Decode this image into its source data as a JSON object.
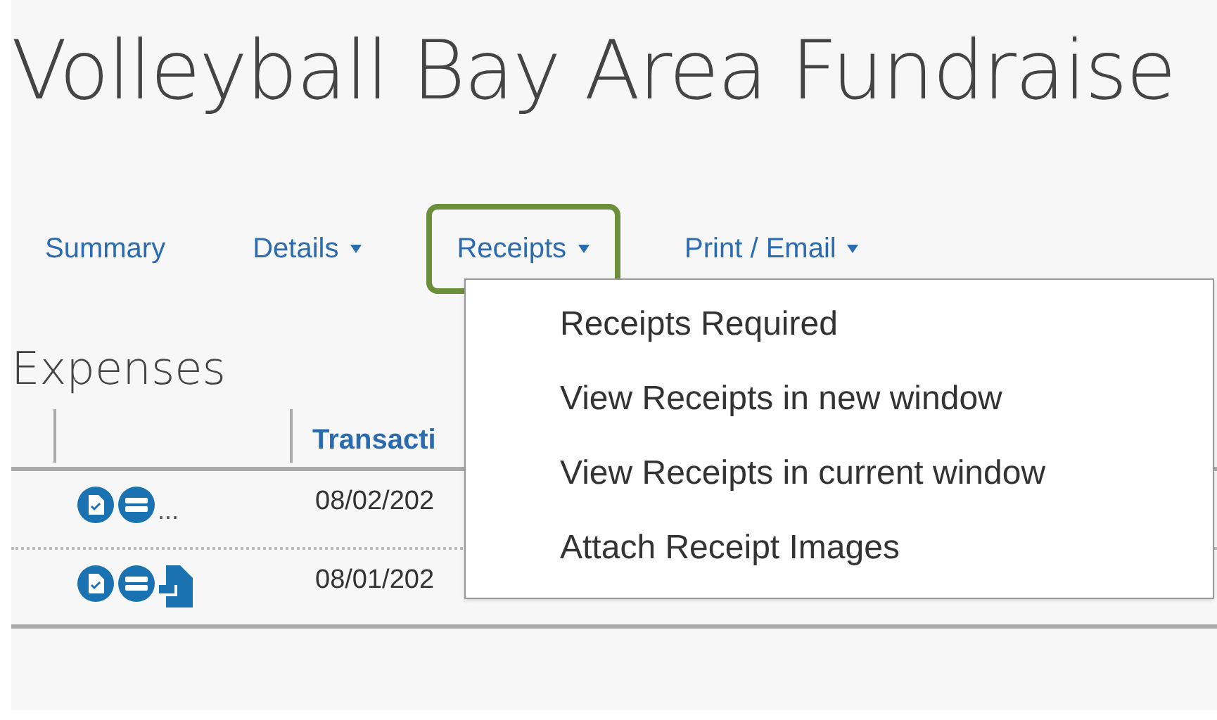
{
  "title": "Volleyball Bay Area Fundraise",
  "tabs": [
    {
      "label": "Summary",
      "caret": false,
      "selected": false
    },
    {
      "label": "Details",
      "caret": true,
      "selected": false
    },
    {
      "label": "Receipts",
      "caret": true,
      "selected": true
    },
    {
      "label": "Print / Email",
      "caret": true,
      "selected": false
    }
  ],
  "section_title": "Expenses",
  "table": {
    "columns": [
      "Transacti"
    ],
    "rows": [
      {
        "extra": {
          "kind": "more",
          "text": "..."
        },
        "date": "08/02/202"
      },
      {
        "extra": {
          "kind": "document"
        },
        "date": "08/01/202"
      }
    ]
  },
  "menu": {
    "items": [
      "Receipts Required",
      "View Receipts in new window",
      "View Receipts in current window",
      "Attach Receipt Images"
    ]
  }
}
